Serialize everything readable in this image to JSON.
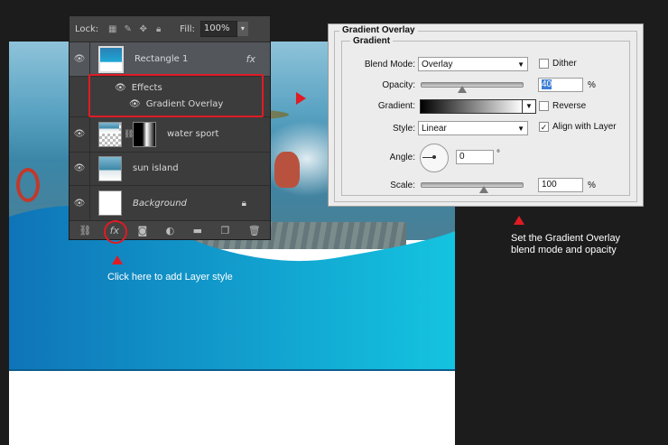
{
  "layers_panel": {
    "lock_label": "Lock:",
    "fill_label": "Fill:",
    "fill_value": "100%",
    "layers": [
      {
        "name": "Rectangle 1",
        "has_fx": true,
        "fx_label": "fx"
      },
      {
        "name": "water sport"
      },
      {
        "name": "sun island"
      },
      {
        "name": "Background",
        "locked": true
      }
    ],
    "effects_label": "Effects",
    "effect_item": "Gradient Overlay",
    "bottom_fx": "fx"
  },
  "gradient_dialog": {
    "title": "Gradient Overlay",
    "section": "Gradient",
    "blend_mode_label": "Blend Mode:",
    "blend_mode_value": "Overlay",
    "dither_label": "Dither",
    "dither_checked": false,
    "opacity_label": "Opacity:",
    "opacity_value": "40",
    "opacity_unit": "%",
    "opacity_level": 40,
    "gradient_label": "Gradient:",
    "reverse_label": "Reverse",
    "reverse_checked": false,
    "style_label": "Style:",
    "style_value": "Linear",
    "align_label": "Align with Layer",
    "align_checked": true,
    "angle_label": "Angle:",
    "angle_value": "0",
    "angle_unit": "°",
    "scale_label": "Scale:",
    "scale_value": "100",
    "scale_unit": "%",
    "scale_level": 100
  },
  "captions": {
    "layer_style_hint": "Click here to add Layer style",
    "gradient_hint_line1": "Set the Gradient Overlay",
    "gradient_hint_line2": "blend mode and opacity"
  },
  "colors": {
    "highlight_red": "#e01b24",
    "wave_blue_dark": "#0f74b8",
    "wave_blue_light": "#14c4e0"
  }
}
